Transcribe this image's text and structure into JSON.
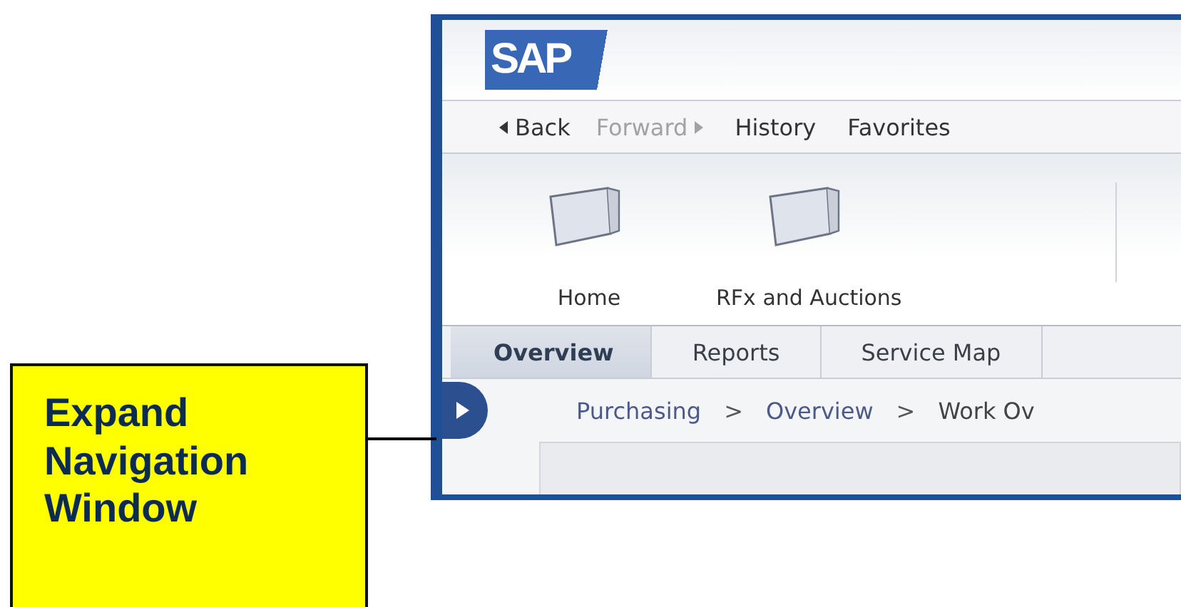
{
  "callout": {
    "text": "Expand Navigation Window"
  },
  "portal": {
    "logo": "SAP",
    "nav": [
      {
        "label": "Back",
        "kind": "back",
        "disabled": false
      },
      {
        "label": "Forward",
        "kind": "forward",
        "disabled": true
      },
      {
        "label": "History",
        "kind": "plain",
        "disabled": false
      },
      {
        "label": "Favorites",
        "kind": "plain",
        "disabled": false
      }
    ],
    "launchpad": [
      {
        "label": "Home"
      },
      {
        "label": "RFx and Auctions"
      }
    ],
    "tabs": [
      {
        "label": "Overview",
        "selected": true
      },
      {
        "label": "Reports",
        "selected": false
      },
      {
        "label": "Service Map",
        "selected": false
      }
    ],
    "breadcrumb": [
      {
        "label": "Purchasing"
      },
      {
        "label": ">"
      },
      {
        "label": "Overview"
      },
      {
        "label": ">"
      },
      {
        "label": "Work Ov"
      }
    ]
  }
}
